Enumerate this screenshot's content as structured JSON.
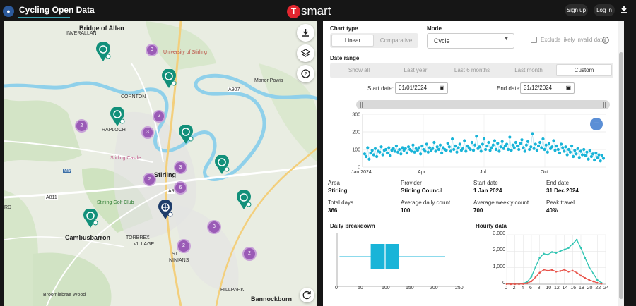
{
  "app": {
    "title": "Cycling Open Data",
    "brand": "smart",
    "brand_badge": "T",
    "sign_up": "Sign up",
    "log_in": "Log in"
  },
  "map": {
    "labels": [
      "Bridge of Allan",
      "INVERALLAN",
      "University of Stirling",
      "Manor Powis",
      "CORNTON",
      "RAPLOCH",
      "Stirling Castle",
      "Stirling",
      "Stirling Golf Club",
      "Cambusbarron",
      "TORBREX",
      "VILLAGE",
      "ST",
      "NINIANS",
      "HILLPARK",
      "Bannockburn",
      "Broomiebrae Wood",
      "A907",
      "A9",
      "A811",
      "M9",
      "RD"
    ],
    "clusters": [
      "3",
      "2",
      "2",
      "3",
      "3",
      "2",
      "6",
      "3",
      "2",
      "2"
    ]
  },
  "controls": {
    "chart_type_label": "Chart type",
    "chart_types": [
      "Linear",
      "Comparative"
    ],
    "chart_type_selected": "Linear",
    "mode_label": "Mode",
    "mode_value": "Cycle",
    "exclude_label": "Exclude likely invalid data",
    "date_range_label": "Date range",
    "ranges": [
      "Show all",
      "Last year",
      "Last 6 months",
      "Last month",
      "Custom"
    ],
    "range_selected": "Custom",
    "start_label": "Start date:",
    "start_value": "01/01/2024",
    "end_label": "End date:",
    "end_value": "31/12/2024"
  },
  "stats": [
    {
      "label": "Area",
      "value": "Stirling"
    },
    {
      "label": "Provider",
      "value": "Stirling Council"
    },
    {
      "label": "Start date",
      "value": "1 Jan 2024"
    },
    {
      "label": "End date",
      "value": "31 Dec 2024"
    },
    {
      "label": "Total days",
      "value": "366"
    },
    {
      "label": "Average daily count",
      "value": "100"
    },
    {
      "label": "Average weekly count",
      "value": "700"
    },
    {
      "label": "Peak travel",
      "value": "40%"
    }
  ],
  "colors": {
    "accent": "#19b4d8",
    "cluster": "#9a5bb6",
    "pin": "#12907a",
    "red": "#e8534a",
    "teal": "#2ec4b2"
  },
  "chart_data": [
    {
      "type": "scatter",
      "title": "",
      "x_ticks": [
        "Jan 2024",
        "Apr",
        "Jul",
        "Oct"
      ],
      "y_ticks": [
        "0",
        "100",
        "200",
        "300"
      ],
      "ylim": [
        0,
        300
      ],
      "values": [
        75,
        60,
        110,
        45,
        80,
        95,
        70,
        105,
        60,
        90,
        85,
        115,
        70,
        95,
        100,
        80,
        110,
        65,
        95,
        105,
        90,
        120,
        85,
        100,
        75,
        110,
        95,
        105,
        80,
        115,
        100,
        90,
        125,
        85,
        105,
        95,
        110,
        75,
        120,
        100,
        90,
        130,
        85,
        110,
        95,
        105,
        140,
        90,
        115,
        100,
        125,
        80,
        110,
        100,
        95,
        135,
        115,
        90,
        160,
        100,
        120,
        85,
        110,
        130,
        95,
        105,
        150,
        90,
        120,
        110,
        100,
        140,
        95,
        125,
        175,
        105,
        115,
        90,
        130,
        160,
        100,
        120,
        140,
        95,
        110,
        125,
        150,
        100,
        135,
        90,
        115,
        145,
        105,
        120,
        130,
        100,
        170,
        95,
        125,
        110,
        140,
        120,
        100,
        135,
        155,
        110,
        90,
        125,
        145,
        100,
        115,
        190,
        105,
        130,
        95,
        120,
        140,
        110,
        160,
        100,
        125,
        85,
        135,
        105,
        115,
        150,
        95,
        120,
        100,
        80,
        130,
        110,
        90,
        115,
        70,
        100,
        85,
        120,
        60,
        95,
        75,
        105,
        55,
        90,
        70,
        100,
        65,
        85,
        45,
        95,
        60,
        75,
        40,
        80,
        55,
        70,
        35,
        65,
        50
      ]
    },
    {
      "type": "box",
      "title": "Daily breakdown",
      "x_ticks": [
        "0",
        "50",
        "100",
        "150",
        "200",
        "250"
      ],
      "whisker_low": 5,
      "q1": 70,
      "median": 100,
      "q3": 128,
      "whisker_high": 225,
      "xlim": [
        0,
        250
      ]
    },
    {
      "type": "line",
      "title": "Hourly data",
      "x": [
        0,
        1,
        2,
        3,
        4,
        5,
        6,
        7,
        8,
        9,
        10,
        11,
        12,
        13,
        14,
        15,
        16,
        17,
        18,
        19,
        20,
        21,
        22,
        23
      ],
      "x_ticks": [
        "0",
        "2",
        "4",
        "6",
        "8",
        "10",
        "12",
        "14",
        "16",
        "18",
        "20",
        "22",
        "24"
      ],
      "y_ticks": [
        "0",
        "1,000",
        "2,000",
        "3,000"
      ],
      "ylim": [
        0,
        3000
      ],
      "series": [
        {
          "values": [
            20,
            10,
            10,
            10,
            40,
            150,
            450,
            1050,
            1600,
            1850,
            1800,
            1950,
            1900,
            2000,
            2100,
            2200,
            2450,
            2700,
            2200,
            1600,
            1050,
            650,
            250,
            80
          ]
        },
        {
          "values": [
            10,
            5,
            5,
            5,
            20,
            60,
            180,
            420,
            700,
            880,
            820,
            870,
            760,
            800,
            880,
            760,
            820,
            700,
            520,
            380,
            260,
            170,
            80,
            30
          ]
        }
      ]
    }
  ]
}
